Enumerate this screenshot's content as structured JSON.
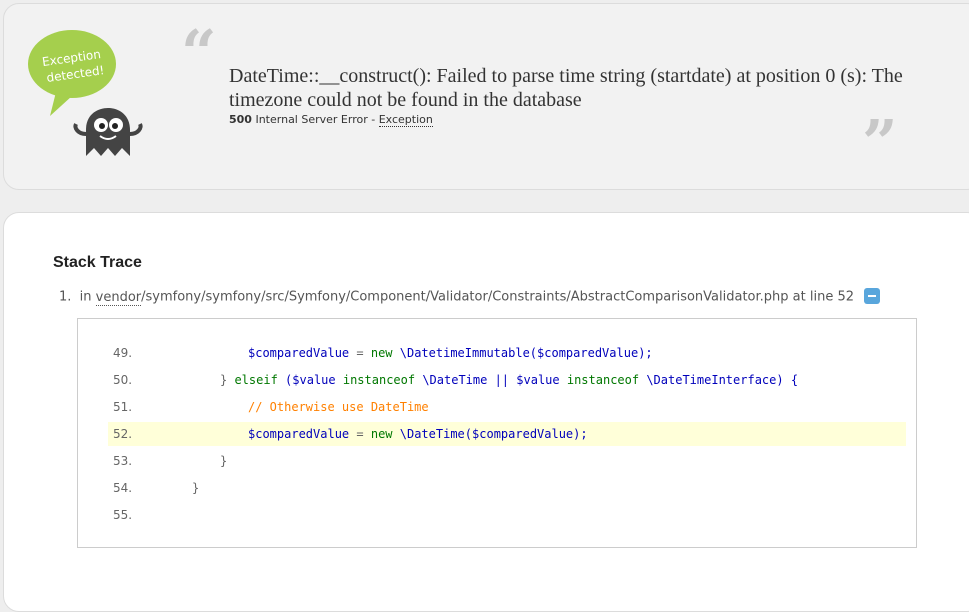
{
  "logo": {
    "bubble_text_line1": "Exception",
    "bubble_text_line2": "detected!"
  },
  "exception": {
    "message": "DateTime::__construct(): Failed to parse time string (startdate) at position 0 (s): The timezone could not be found in the database",
    "status_code": "500",
    "status_text": "Internal Server Error - ",
    "exception_class": "Exception"
  },
  "trace": {
    "title": "Stack Trace",
    "items": [
      {
        "number": "1.",
        "prefix": "in ",
        "vendor": "vendor",
        "path": "/symfony/symfony/src/Symfony/Component/Validator/Constraints/AbstractComparisonValidator.php",
        "line_text": " at line 52"
      }
    ],
    "code": [
      {
        "ln": "49.",
        "parts": [
          "$comparedValue",
          " = ",
          "new",
          " \\DatetimeImmutable(",
          "$comparedValue",
          ");"
        ]
      },
      {
        "ln": "50.",
        "parts": [
          "} ",
          "elseif",
          " (",
          "$value",
          " instanceof",
          " \\DateTime || ",
          "$value",
          " instanceof",
          " \\DateTimeInterface) {"
        ]
      },
      {
        "ln": "51.",
        "parts": [
          "// Otherwise use DateTime"
        ]
      },
      {
        "ln": "52.",
        "parts": [
          "$comparedValue",
          " = ",
          "new",
          " \\DateTime(",
          "$comparedValue",
          ");"
        ]
      },
      {
        "ln": "53.",
        "parts": [
          "}"
        ]
      },
      {
        "ln": "54.",
        "parts": [
          "}"
        ]
      },
      {
        "ln": "55.",
        "parts": [
          ""
        ]
      }
    ]
  }
}
